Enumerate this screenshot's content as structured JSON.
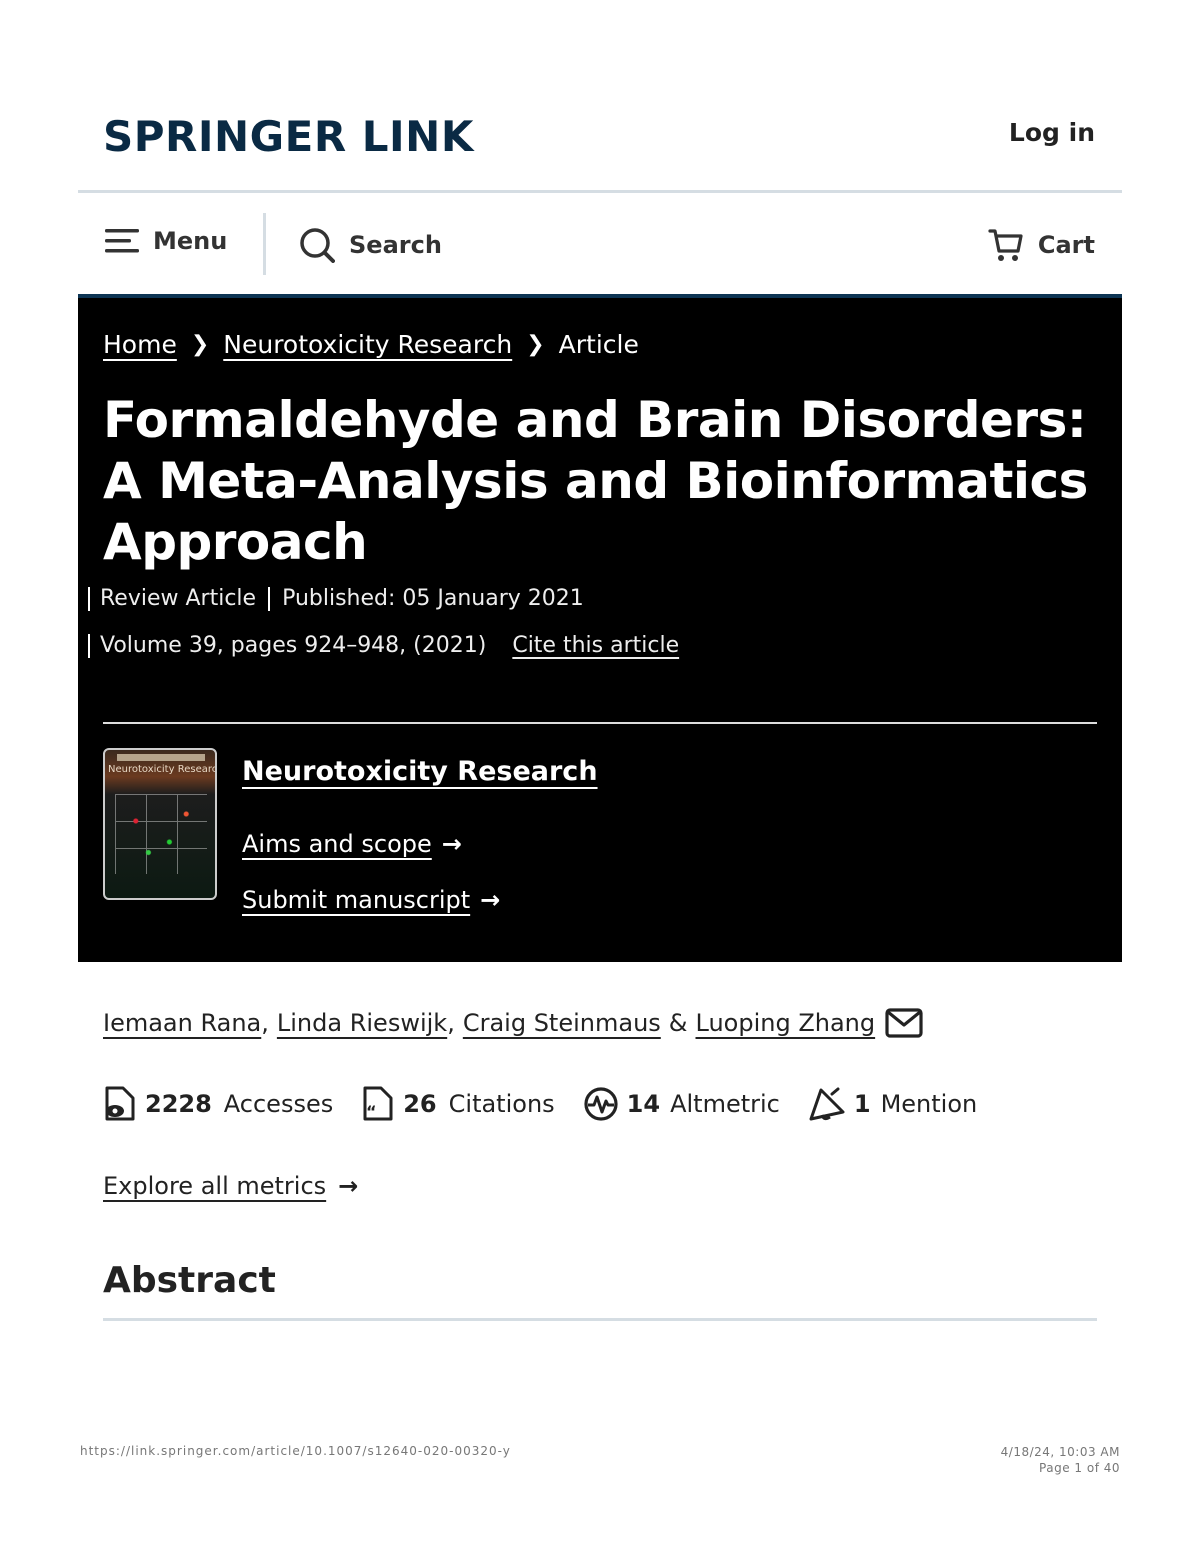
{
  "header": {
    "logo": "SPRINGER LINK",
    "login": "Log in"
  },
  "nav": {
    "menu": "Menu",
    "search": "Search",
    "cart": "Cart"
  },
  "breadcrumb": {
    "home": "Home",
    "journal": "Neurotoxicity Research",
    "current": "Article"
  },
  "article": {
    "title": "Formaldehyde and Brain Disorders: A Meta-Analysis and Bioinformatics Approach",
    "type": "Review Article",
    "published": "Published: 05 January 2021",
    "volume": "Volume 39, pages 924–948, (2021)",
    "cite": "Cite this article"
  },
  "journal": {
    "cover_title": "Neurotoxicity Research",
    "name": "Neurotoxicity Research",
    "aims": "Aims and scope",
    "submit": "Submit manuscript"
  },
  "authors": {
    "a1": "Iemaan Rana",
    "a2": "Linda Rieswijk",
    "a3": "Craig Steinmaus",
    "amp": "&",
    "a4": "Luoping Zhang"
  },
  "metrics": {
    "accesses_count": "2228",
    "accesses_label": "Accesses",
    "citations_count": "26",
    "citations_label": "Citations",
    "altmetric_count": "14",
    "altmetric_label": "Altmetric",
    "mention_count": "1",
    "mention_label": "Mention",
    "explore": "Explore all metrics"
  },
  "sections": {
    "abstract": "Abstract"
  },
  "footer": {
    "url": "https://link.springer.com/article/10.1007/s12640-020-00320-y",
    "datetime": "4/18/24, 10:03 AM",
    "page": "Page 1 of 40"
  },
  "colors": {
    "brand_navy": "#0a2a44",
    "hero_bg": "#000000",
    "hero_accent": "#0d3554",
    "rule": "#d5dde3"
  }
}
